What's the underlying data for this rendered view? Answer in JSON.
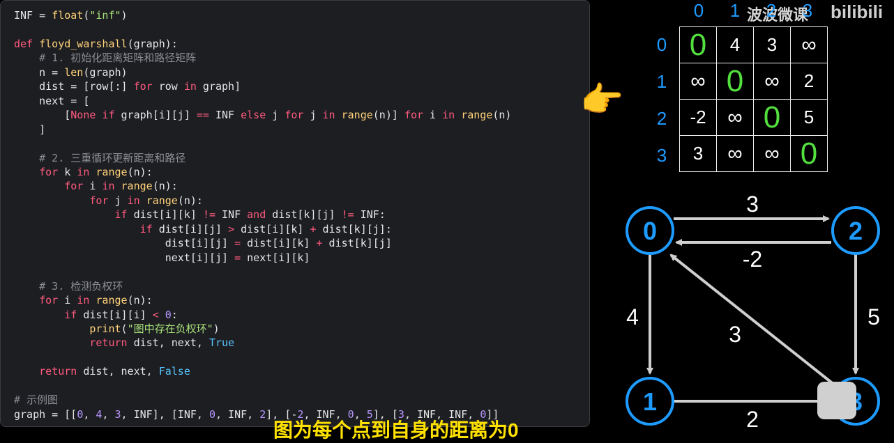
{
  "code": {
    "lines": [
      [
        {
          "t": "INF = "
        },
        {
          "t": "float",
          "c": "f"
        },
        {
          "t": "("
        },
        {
          "t": "\"inf\"",
          "c": "s"
        },
        {
          "t": ")"
        }
      ],
      [],
      [
        {
          "t": "def ",
          "c": "k"
        },
        {
          "t": "floyd_warshall",
          "c": "f"
        },
        {
          "t": "(graph):"
        }
      ],
      [
        {
          "t": "    "
        },
        {
          "t": "# 1. 初始化距离矩阵和路径矩阵",
          "c": "c"
        }
      ],
      [
        {
          "t": "    n = "
        },
        {
          "t": "len",
          "c": "f"
        },
        {
          "t": "(graph)"
        }
      ],
      [
        {
          "t": "    dist = [row[:] "
        },
        {
          "t": "for",
          "c": "k"
        },
        {
          "t": " row "
        },
        {
          "t": "in",
          "c": "k"
        },
        {
          "t": " graph]"
        }
      ],
      [
        {
          "t": "    next = ["
        }
      ],
      [
        {
          "t": "        ["
        },
        {
          "t": "None",
          "c": "k"
        },
        {
          "t": " "
        },
        {
          "t": "if",
          "c": "k"
        },
        {
          "t": " graph[i][j] "
        },
        {
          "t": "==",
          "c": "k"
        },
        {
          "t": " INF "
        },
        {
          "t": "else",
          "c": "k"
        },
        {
          "t": " j "
        },
        {
          "t": "for",
          "c": "k"
        },
        {
          "t": " j "
        },
        {
          "t": "in",
          "c": "k"
        },
        {
          "t": " "
        },
        {
          "t": "range",
          "c": "f"
        },
        {
          "t": "(n)] "
        },
        {
          "t": "for",
          "c": "k"
        },
        {
          "t": " i "
        },
        {
          "t": "in",
          "c": "k"
        },
        {
          "t": " "
        },
        {
          "t": "range",
          "c": "f"
        },
        {
          "t": "(n)"
        }
      ],
      [
        {
          "t": "    ]"
        }
      ],
      [],
      [
        {
          "t": "    "
        },
        {
          "t": "# 2. 三重循环更新距离和路径",
          "c": "c"
        }
      ],
      [
        {
          "t": "    "
        },
        {
          "t": "for",
          "c": "k"
        },
        {
          "t": " k "
        },
        {
          "t": "in",
          "c": "k"
        },
        {
          "t": " "
        },
        {
          "t": "range",
          "c": "f"
        },
        {
          "t": "(n):"
        }
      ],
      [
        {
          "t": "        "
        },
        {
          "t": "for",
          "c": "k"
        },
        {
          "t": " i "
        },
        {
          "t": "in",
          "c": "k"
        },
        {
          "t": " "
        },
        {
          "t": "range",
          "c": "f"
        },
        {
          "t": "(n):"
        }
      ],
      [
        {
          "t": "            "
        },
        {
          "t": "for",
          "c": "k"
        },
        {
          "t": " j "
        },
        {
          "t": "in",
          "c": "k"
        },
        {
          "t": " "
        },
        {
          "t": "range",
          "c": "f"
        },
        {
          "t": "(n):"
        }
      ],
      [
        {
          "t": "                "
        },
        {
          "t": "if",
          "c": "k"
        },
        {
          "t": " dist[i][k] "
        },
        {
          "t": "!=",
          "c": "k"
        },
        {
          "t": " INF "
        },
        {
          "t": "and",
          "c": "k"
        },
        {
          "t": " dist[k][j] "
        },
        {
          "t": "!=",
          "c": "k"
        },
        {
          "t": " INF:"
        }
      ],
      [
        {
          "t": "                    "
        },
        {
          "t": "if",
          "c": "k"
        },
        {
          "t": " dist[i][j] "
        },
        {
          "t": ">",
          "c": "k"
        },
        {
          "t": " dist[i][k] "
        },
        {
          "t": "+",
          "c": "k"
        },
        {
          "t": " dist[k][j]:"
        }
      ],
      [
        {
          "t": "                        dist[i][j] "
        },
        {
          "t": "=",
          "c": "k"
        },
        {
          "t": " dist[i][k] "
        },
        {
          "t": "+",
          "c": "k"
        },
        {
          "t": " dist[k][j]"
        }
      ],
      [
        {
          "t": "                        next[i][j] "
        },
        {
          "t": "=",
          "c": "k"
        },
        {
          "t": " next[i][k]"
        }
      ],
      [],
      [
        {
          "t": "    "
        },
        {
          "t": "# 3. 检测负权环",
          "c": "c"
        }
      ],
      [
        {
          "t": "    "
        },
        {
          "t": "for",
          "c": "k"
        },
        {
          "t": " i "
        },
        {
          "t": "in",
          "c": "k"
        },
        {
          "t": " "
        },
        {
          "t": "range",
          "c": "f"
        },
        {
          "t": "(n):"
        }
      ],
      [
        {
          "t": "        "
        },
        {
          "t": "if",
          "c": "k"
        },
        {
          "t": " dist[i][i] "
        },
        {
          "t": "<",
          "c": "k"
        },
        {
          "t": " "
        },
        {
          "t": "0",
          "c": "n"
        },
        {
          "t": ":"
        }
      ],
      [
        {
          "t": "            "
        },
        {
          "t": "print",
          "c": "f"
        },
        {
          "t": "("
        },
        {
          "t": "\"图中存在负权环\"",
          "c": "s"
        },
        {
          "t": ")"
        }
      ],
      [
        {
          "t": "            "
        },
        {
          "t": "return",
          "c": "k"
        },
        {
          "t": " dist, next, "
        },
        {
          "t": "True",
          "c": "b"
        }
      ],
      [],
      [
        {
          "t": "    "
        },
        {
          "t": "return",
          "c": "k"
        },
        {
          "t": " dist, next, "
        },
        {
          "t": "False",
          "c": "b"
        }
      ],
      [],
      [
        {
          "t": "# 示例图",
          "c": "c"
        }
      ],
      [
        {
          "t": "graph = [["
        },
        {
          "t": "0",
          "c": "n"
        },
        {
          "t": ", "
        },
        {
          "t": "4",
          "c": "n"
        },
        {
          "t": ", "
        },
        {
          "t": "3",
          "c": "n"
        },
        {
          "t": ", INF], [INF, "
        },
        {
          "t": "0",
          "c": "n"
        },
        {
          "t": ", INF, "
        },
        {
          "t": "2",
          "c": "n"
        },
        {
          "t": "], [-"
        },
        {
          "t": "2",
          "c": "n"
        },
        {
          "t": ", INF, "
        },
        {
          "t": "0",
          "c": "n"
        },
        {
          "t": ", "
        },
        {
          "t": "5",
          "c": "n"
        },
        {
          "t": "], ["
        },
        {
          "t": "3",
          "c": "n"
        },
        {
          "t": ", INF, INF, "
        },
        {
          "t": "0",
          "c": "n"
        },
        {
          "t": "]]"
        }
      ]
    ]
  },
  "matrix": {
    "col_labels": [
      "0",
      "1",
      "2",
      "3"
    ],
    "row_labels": [
      "0",
      "1",
      "2",
      "3"
    ],
    "rows": [
      [
        "0",
        "4",
        "3",
        "∞"
      ],
      [
        "∞",
        "0",
        "∞",
        "2"
      ],
      [
        "-2",
        "∞",
        "0",
        "5"
      ],
      [
        "3",
        "∞",
        "∞",
        "0"
      ]
    ]
  },
  "watermark": "波波微课",
  "bili_logo": "bilibili",
  "pointer_icon": "pointing-hand-icon",
  "graph": {
    "nodes": [
      "0",
      "1",
      "2",
      "3"
    ],
    "edges": [
      {
        "from": "0",
        "to": "2",
        "label": "3"
      },
      {
        "from": "2",
        "to": "0",
        "label": "-2"
      },
      {
        "from": "0",
        "to": "1",
        "label": "4"
      },
      {
        "from": "3",
        "to": "0",
        "label": "3"
      },
      {
        "from": "2",
        "to": "3",
        "label": "5"
      },
      {
        "from": "1",
        "to": "3",
        "label": "2"
      }
    ],
    "node_color": "#1e9bff"
  },
  "subtitle": "图为每个点到自身的距离为0"
}
